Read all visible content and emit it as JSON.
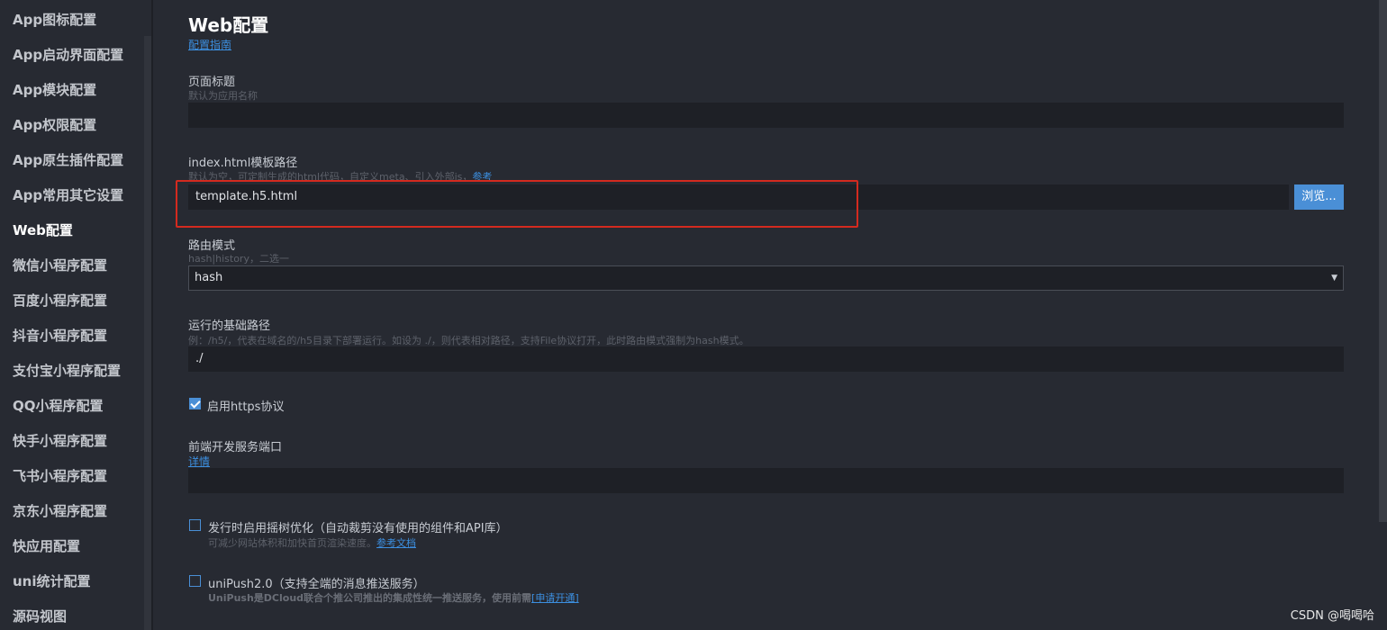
{
  "sidebar": {
    "items": [
      {
        "label": "App图标配置"
      },
      {
        "label": "App启动界面配置"
      },
      {
        "label": "App模块配置"
      },
      {
        "label": "App权限配置"
      },
      {
        "label": "App原生插件配置"
      },
      {
        "label": "App常用其它设置"
      },
      {
        "label": "Web配置",
        "active": true
      },
      {
        "label": "微信小程序配置"
      },
      {
        "label": "百度小程序配置"
      },
      {
        "label": "抖音小程序配置"
      },
      {
        "label": "支付宝小程序配置"
      },
      {
        "label": "QQ小程序配置"
      },
      {
        "label": "快手小程序配置"
      },
      {
        "label": "飞书小程序配置"
      },
      {
        "label": "京东小程序配置"
      },
      {
        "label": "快应用配置"
      },
      {
        "label": "uni统计配置"
      },
      {
        "label": "源码视图"
      }
    ]
  },
  "main": {
    "title": "Web配置",
    "guide_link": "配置指南",
    "page_title_field": {
      "label": "页面标题",
      "hint": "默认为应用名称",
      "value": ""
    },
    "template_field": {
      "label": "index.html模板路径",
      "hint": "默认为空，可定制生成的html代码，自定义meta、引入外部js，",
      "hint_link": "参考",
      "value": "template.h5.html",
      "browse_label": "浏览..."
    },
    "router_field": {
      "label": "路由模式",
      "hint": "hash|history，二选一",
      "selected": "hash"
    },
    "base_path_field": {
      "label": "运行的基础路径",
      "hint": "例：/h5/，代表在域名的/h5目录下部署运行。如设为 ./，则代表相对路径，支持File协议打开，此时路由模式强制为hash模式。",
      "value": "./"
    },
    "https_option": {
      "label": "启用https协议",
      "checked": true
    },
    "dev_port_field": {
      "label": "前端开发服务端口",
      "link": "详情",
      "value": ""
    },
    "treeshake_option": {
      "label": "发行时启用摇树优化（自动裁剪没有使用的组件和API库）",
      "hint": "可减少网站体积和加快首页渲染速度。",
      "hint_link": "参考文档",
      "checked": false
    },
    "unipush_option": {
      "label": "uniPush2.0（支持全端的消息推送服务）",
      "hint": "UniPush是DCloud联合个推公司推出的集成性统一推送服务，使用前需",
      "hint_link": "[申请开通]",
      "checked": false
    }
  },
  "watermark": "CSDN @喝喝哈",
  "colors": {
    "background": "#272a32",
    "input_bg": "#1e2026",
    "accent": "#4a8fd6",
    "link": "#3c8fe0",
    "highlight": "#d42a1f"
  }
}
